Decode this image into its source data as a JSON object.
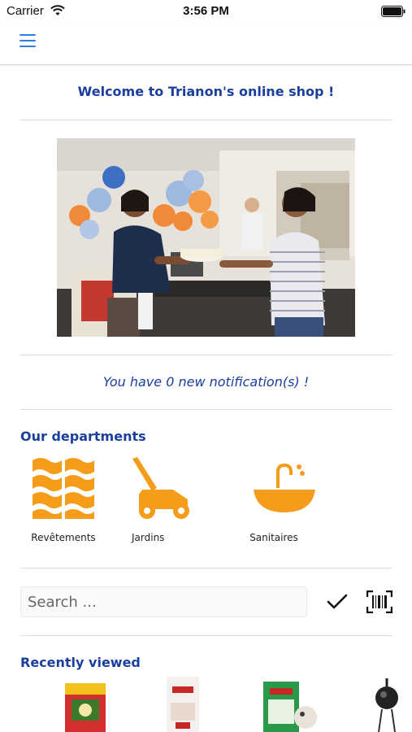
{
  "status": {
    "carrier": "Carrier",
    "time": "3:56 PM"
  },
  "nav": {
    "menu_icon": "hamburger-menu-icon"
  },
  "welcome": "Welcome to Trianon's online shop !",
  "notification": "You have 0 new notification(s) !",
  "departments": {
    "title": "Our departments",
    "items": [
      {
        "label": "Revêtements",
        "icon": "tiles-icon"
      },
      {
        "label": "Jardins",
        "icon": "lawnmower-icon"
      },
      {
        "label": "Sanitaires",
        "icon": "sink-icon"
      }
    ]
  },
  "search": {
    "placeholder": "Search ...",
    "value": ""
  },
  "recent": {
    "title": "Recently viewed"
  },
  "colors": {
    "accent": "#1a3f9c",
    "icon_orange": "#f59c1a",
    "menu_blue": "#2f7fe0"
  }
}
